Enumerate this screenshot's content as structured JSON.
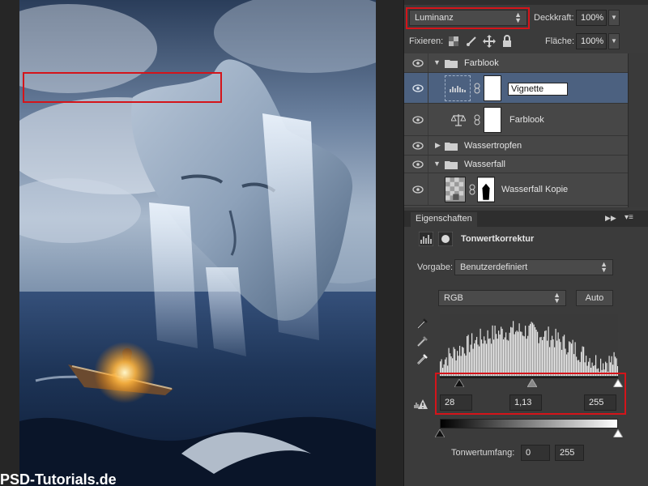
{
  "watermark_text": "PSD-Tutorials.de",
  "layers_panel": {
    "blend_mode": "Luminanz",
    "opacity_label": "Deckkraft:",
    "opacity_value": "100%",
    "lock_label": "Fixieren:",
    "fill_label": "Fläche:",
    "fill_value": "100%",
    "layers": [
      {
        "name": "Farblook",
        "type": "group",
        "expanded": true
      },
      {
        "name": "Vignette",
        "type": "levels-adjustment",
        "selected": true,
        "editing": true
      },
      {
        "name": "Farblook",
        "type": "color-balance-adjustment"
      },
      {
        "name": "Wassertropfen",
        "type": "group",
        "expanded": false
      },
      {
        "name": "Wasserfall",
        "type": "group",
        "expanded": true
      },
      {
        "name": "Wasserfall Kopie",
        "type": "pixel-layer-with-mask"
      }
    ]
  },
  "properties_panel": {
    "tab_label": "Eigenschaften",
    "title": "Tonwertkorrektur",
    "preset_label": "Vorgabe:",
    "preset_value": "Benutzerdefiniert",
    "channel_value": "RGB",
    "auto_label": "Auto",
    "input_black": "28",
    "input_gamma": "1,13",
    "input_white": "255",
    "output_label": "Tonwertumfang:",
    "output_black": "0",
    "output_white": "255"
  },
  "colors": {
    "highlight": "#d4141a",
    "selected_layer": "#4c6180",
    "panel_bg": "#3b3b3b"
  }
}
